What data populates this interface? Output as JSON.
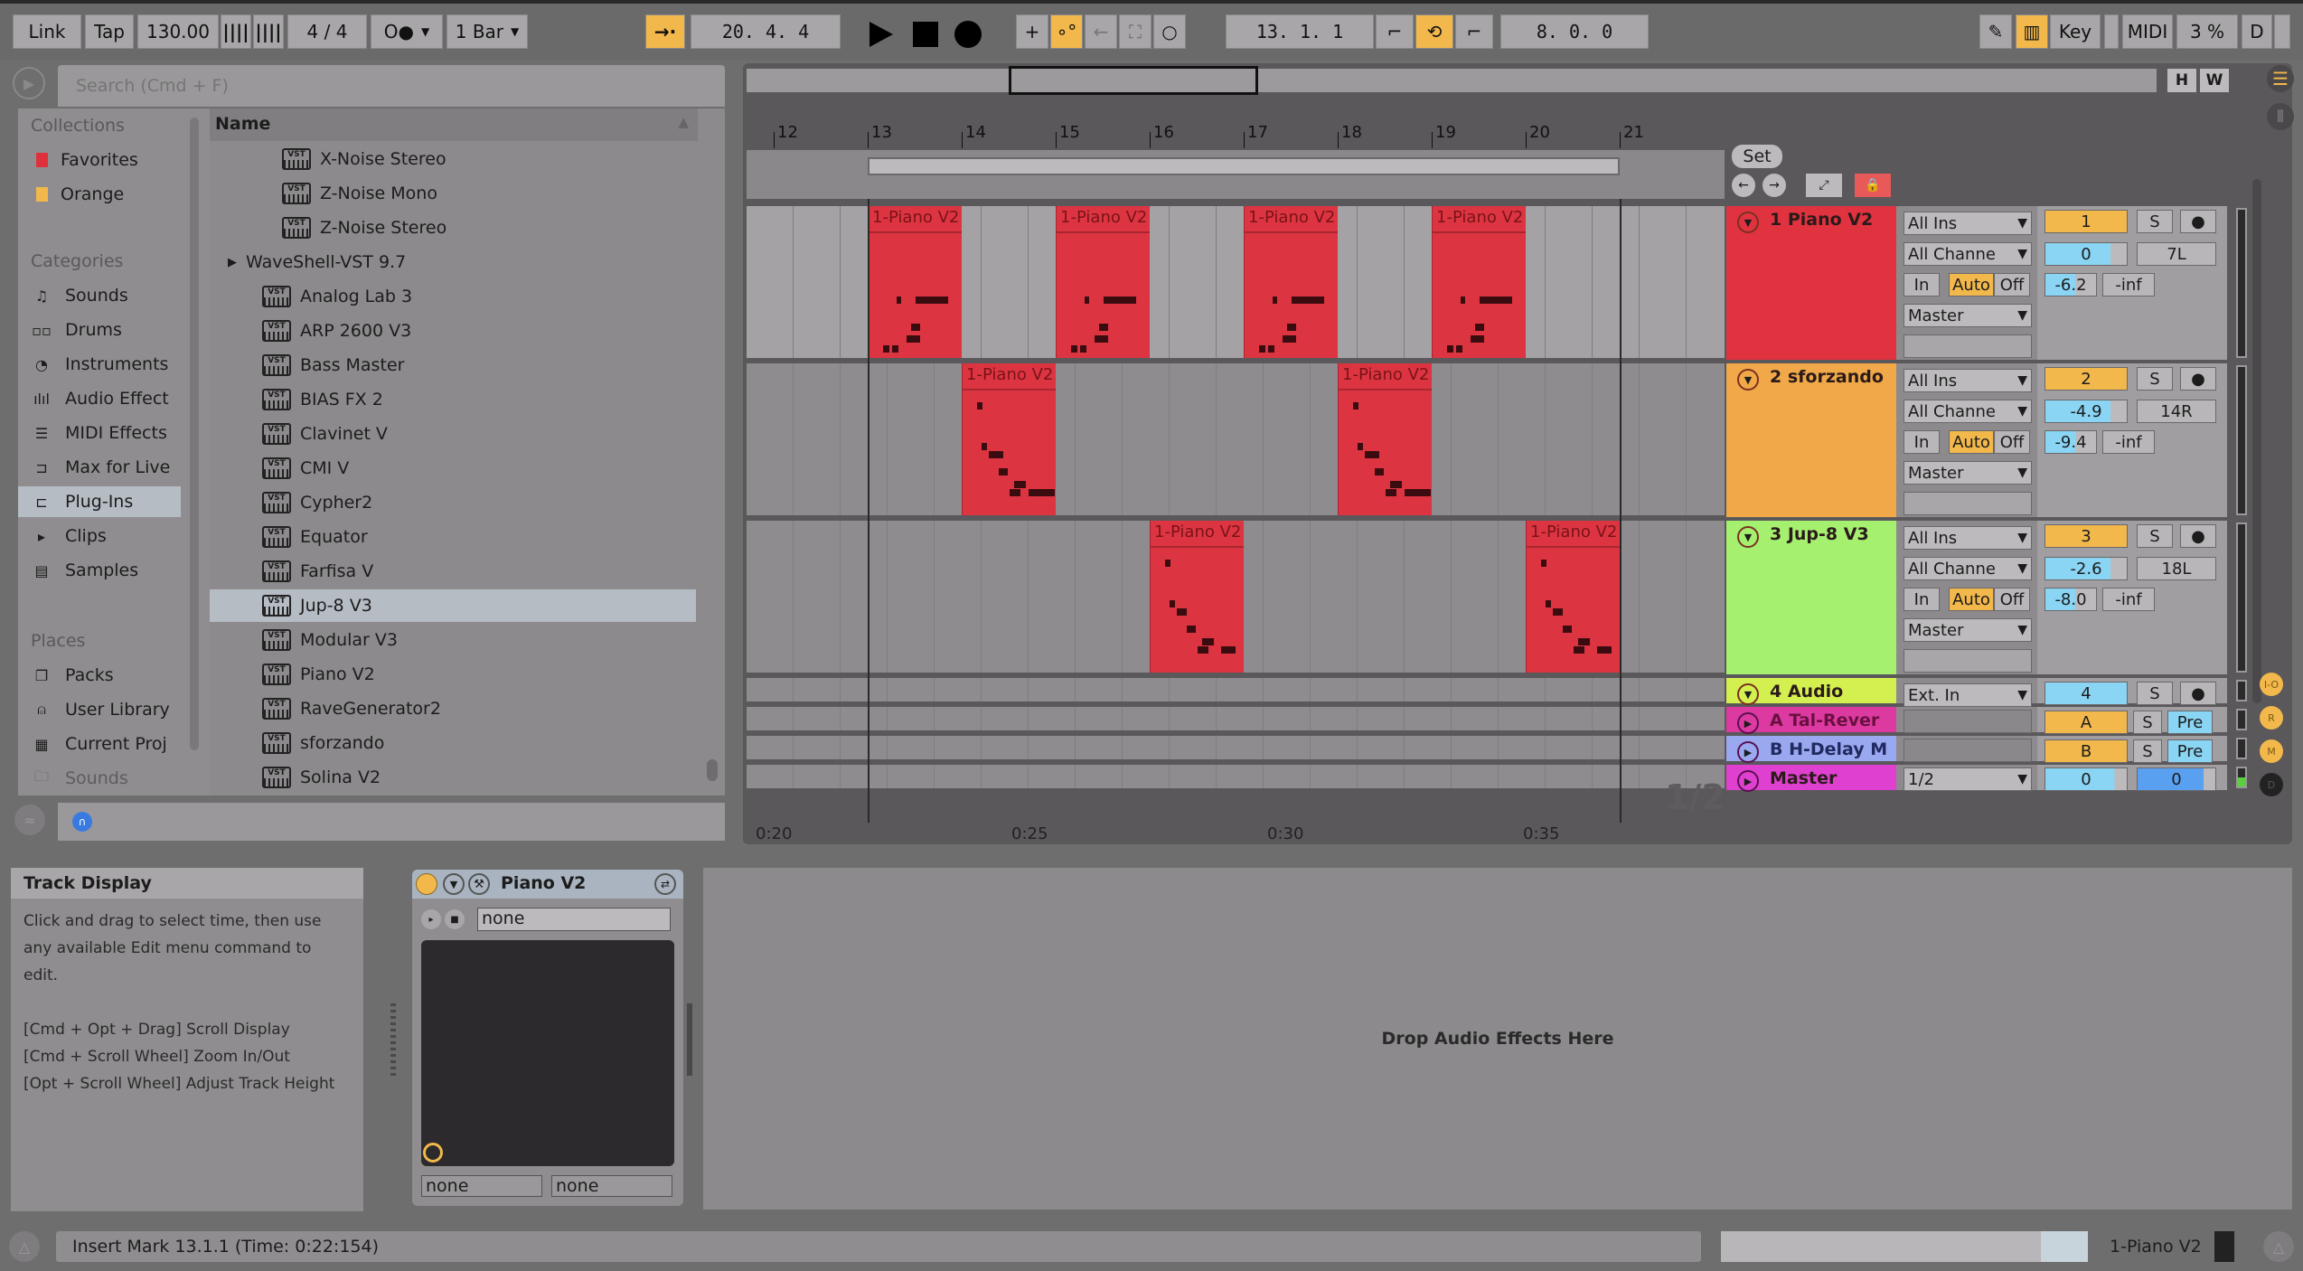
{
  "toolbar": {
    "link": "Link",
    "tap": "Tap",
    "tempo": "130.00",
    "time_signature": "4 / 4",
    "metronome": "O●",
    "quantize": "1 Bar",
    "arrangement_position": "20.   4.   4",
    "loop_start": "13.   1.   1",
    "loop_length": "8.   0.   0",
    "key": "Key",
    "midi": "MIDI",
    "cpu": "3 %",
    "d": "D"
  },
  "browser": {
    "search_placeholder": "Search (Cmd + F)",
    "collections_title": "Collections",
    "collections": [
      {
        "label": "Favorites",
        "color": "#e0303c"
      },
      {
        "label": "Orange",
        "color": "#f2b84b"
      }
    ],
    "categories_title": "Categories",
    "categories": [
      {
        "label": "Sounds",
        "icon": "music-note-icon"
      },
      {
        "label": "Drums",
        "icon": "drum-pads-icon"
      },
      {
        "label": "Instruments",
        "icon": "instrument-knob-icon"
      },
      {
        "label": "Audio Effect",
        "icon": "waveform-icon"
      },
      {
        "label": "MIDI Effects",
        "icon": "midi-lines-icon"
      },
      {
        "label": "Max for Live",
        "icon": "max-icon"
      },
      {
        "label": "Plug-Ins",
        "icon": "plugin-icon",
        "selected": true
      },
      {
        "label": "Clips",
        "icon": "clip-icon"
      },
      {
        "label": "Samples",
        "icon": "sample-icon"
      }
    ],
    "places_title": "Places",
    "places": [
      {
        "label": "Packs",
        "icon": "packs-icon"
      },
      {
        "label": "User Library",
        "icon": "user-icon"
      },
      {
        "label": "Current Proj",
        "icon": "project-icon"
      },
      {
        "label": "Sounds",
        "icon": "folder-icon"
      }
    ],
    "column_header": "Name",
    "files": [
      {
        "label": "X-Noise Stereo",
        "indent": 2,
        "type": "vst-fx"
      },
      {
        "label": "Z-Noise Mono",
        "indent": 2,
        "type": "vst-fx"
      },
      {
        "label": "Z-Noise Stereo",
        "indent": 2,
        "type": "vst-fx"
      },
      {
        "label": "WaveShell-VST 9.7",
        "indent": 1,
        "type": "folder"
      },
      {
        "label": "Analog Lab 3",
        "indent": 1,
        "type": "vst"
      },
      {
        "label": "ARP 2600 V3",
        "indent": 1,
        "type": "vst"
      },
      {
        "label": "Bass Master",
        "indent": 1,
        "type": "vst"
      },
      {
        "label": "BIAS FX 2",
        "indent": 1,
        "type": "vst-fx"
      },
      {
        "label": "Clavinet V",
        "indent": 1,
        "type": "vst"
      },
      {
        "label": "CMI V",
        "indent": 1,
        "type": "vst"
      },
      {
        "label": "Cypher2",
        "indent": 1,
        "type": "vst"
      },
      {
        "label": "Equator",
        "indent": 1,
        "type": "vst"
      },
      {
        "label": "Farfisa V",
        "indent": 1,
        "type": "vst"
      },
      {
        "label": "Jup-8 V3",
        "indent": 1,
        "type": "vst",
        "selected": true
      },
      {
        "label": "Modular V3",
        "indent": 1,
        "type": "vst"
      },
      {
        "label": "Piano V2",
        "indent": 1,
        "type": "vst"
      },
      {
        "label": "RaveGenerator2",
        "indent": 1,
        "type": "vst"
      },
      {
        "label": "sforzando",
        "indent": 1,
        "type": "vst"
      },
      {
        "label": "Solina V2",
        "indent": 1,
        "type": "vst"
      }
    ]
  },
  "arrangement": {
    "bar_numbers": [
      "12",
      "13",
      "14",
      "15",
      "16",
      "17",
      "18",
      "19",
      "20",
      "21"
    ],
    "time_labels": [
      "0:20",
      "0:25",
      "0:30",
      "0:35"
    ],
    "overview_buttons": [
      "H",
      "W"
    ],
    "set_button": "Set",
    "loop_start_bar": 13,
    "loop_end_bar": 21,
    "grid_ratio": "1/2",
    "clip_label": "1-Piano V2",
    "tracks": [
      {
        "name": "1 Piano V2",
        "color": "#e0333f",
        "fold": "down",
        "input": "All Ins",
        "channel": "All Channe",
        "monitor": [
          "In",
          "Auto",
          "Off"
        ],
        "output": "Master",
        "number": "1",
        "volume": "0",
        "pan": "7L",
        "send_a": "-6.2",
        "send_b": "-inf",
        "clips": [
          13,
          15,
          17,
          19
        ]
      },
      {
        "name": "2 sforzando",
        "color": "#f0a848",
        "fold": "down",
        "input": "All Ins",
        "channel": "All Channe",
        "monitor": [
          "In",
          "Auto",
          "Off"
        ],
        "output": "Master",
        "number": "2",
        "volume": "-4.9",
        "pan": "14R",
        "send_a": "-9.4",
        "send_b": "-inf",
        "clips": [
          14,
          18
        ]
      },
      {
        "name": "3 Jup-8 V3",
        "color": "#a6f070",
        "fold": "down",
        "input": "All Ins",
        "channel": "All Channe",
        "monitor": [
          "In",
          "Auto",
          "Off"
        ],
        "output": "Master",
        "number": "3",
        "volume": "-2.6",
        "pan": "18L",
        "send_a": "-8.0",
        "send_b": "-inf",
        "clips": [
          16,
          20
        ]
      },
      {
        "name": "4 Audio",
        "color": "#d4f050",
        "input": "Ext. In",
        "number": "4"
      },
      {
        "name": "A Tal-Rever",
        "color": "#dc3aa0",
        "number": "A",
        "pre": "Pre"
      },
      {
        "name": "B H-Delay M",
        "color": "#9aa8f0",
        "number": "B",
        "pre": "Pre"
      },
      {
        "name": "Master",
        "color": "#e040d0",
        "output": "1/2",
        "volume": "0",
        "pan": "0"
      }
    ],
    "side_buttons": [
      "I-O",
      "R",
      "M",
      "D"
    ]
  },
  "detail": {
    "info_title": "Track Display",
    "info_lines": [
      "Click and drag to select time, then use",
      "any available Edit menu command to",
      "edit.",
      "",
      "[Cmd + Opt + Drag] Scroll Display",
      "[Cmd + Scroll Wheel] Zoom In/Out",
      "[Opt + Scroll Wheel] Adjust Track Height"
    ],
    "device_name": "Piano V2",
    "preset": "none",
    "param_a": "none",
    "param_b": "none",
    "drop_hint": "Drop Audio Effects Here"
  },
  "status": {
    "message": "Insert Mark 13.1.1 (Time: 0:22:154)",
    "selected_clip": "1-Piano V2"
  }
}
